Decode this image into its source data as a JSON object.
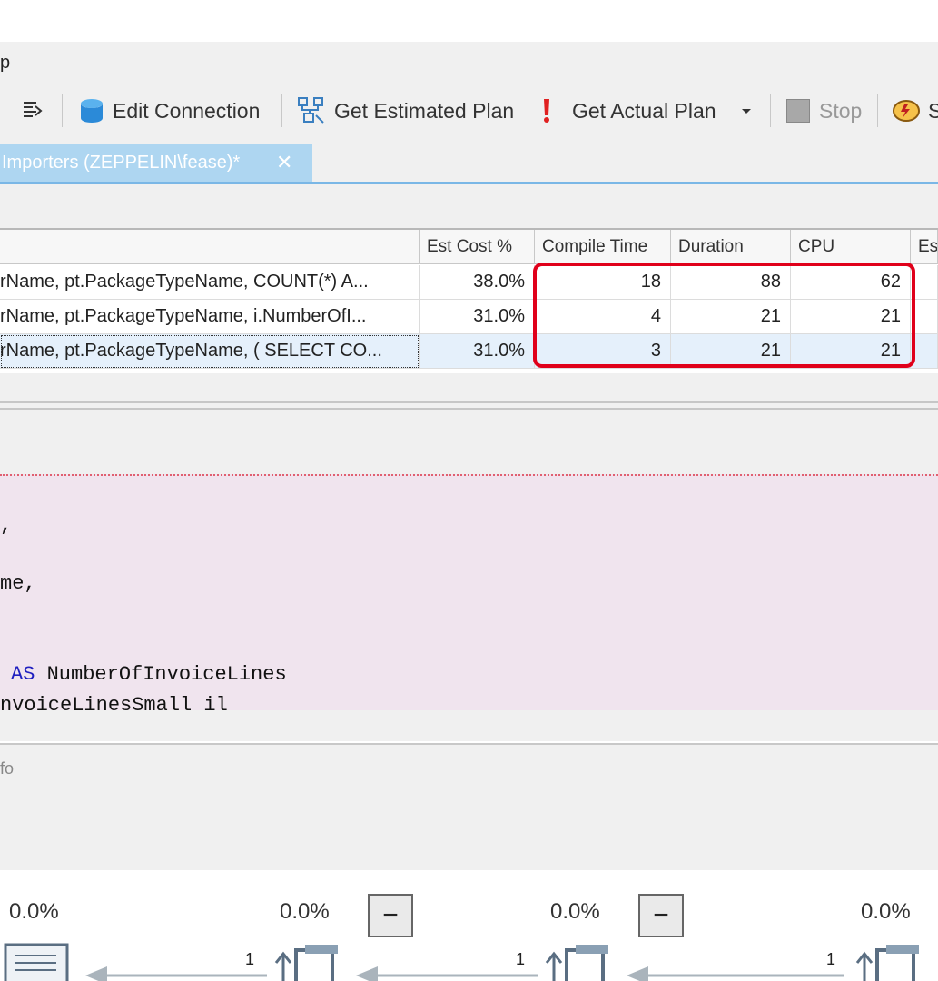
{
  "menu": {
    "partial_label": "p"
  },
  "toolbar": {
    "edit_connection": "Edit Connection",
    "get_estimated_plan": "Get Estimated Plan",
    "get_actual_plan": "Get Actual Plan",
    "stop": "Stop",
    "partial_last": "S"
  },
  "tab": {
    "title": "Importers (ZEPPELIN\\fease)*",
    "close": "✕"
  },
  "grid": {
    "headers": [
      "Est Cost %",
      "Compile Time",
      "Duration",
      "CPU",
      "Es"
    ],
    "rows": [
      {
        "statement": "rName, pt.PackageTypeName, COUNT(*) A...",
        "est_cost": "38.0%",
        "compile_time": "18",
        "duration": "88",
        "cpu": "62"
      },
      {
        "statement": "rName, pt.PackageTypeName, i.NumberOfI...",
        "est_cost": "31.0%",
        "compile_time": "4",
        "duration": "21",
        "cpu": "21"
      },
      {
        "statement": "rName, pt.PackageTypeName, ( SELECT CO...",
        "est_cost": "31.0%",
        "compile_time": "3",
        "duration": "21",
        "cpu": "21"
      }
    ]
  },
  "editor": {
    "line1": ",",
    "line2": "me,",
    "line3_keyword": "AS",
    "line3_rest": " NumberOfInvoiceLines",
    "line4": "nvoiceLinesSmall il"
  },
  "info": {
    "partial_label": "fo"
  },
  "plan": {
    "percentages": [
      "0.0%",
      "0.0%",
      "0.0%",
      "0.0%"
    ],
    "minus": "−",
    "row_counts": [
      "1",
      "1",
      "1"
    ]
  }
}
